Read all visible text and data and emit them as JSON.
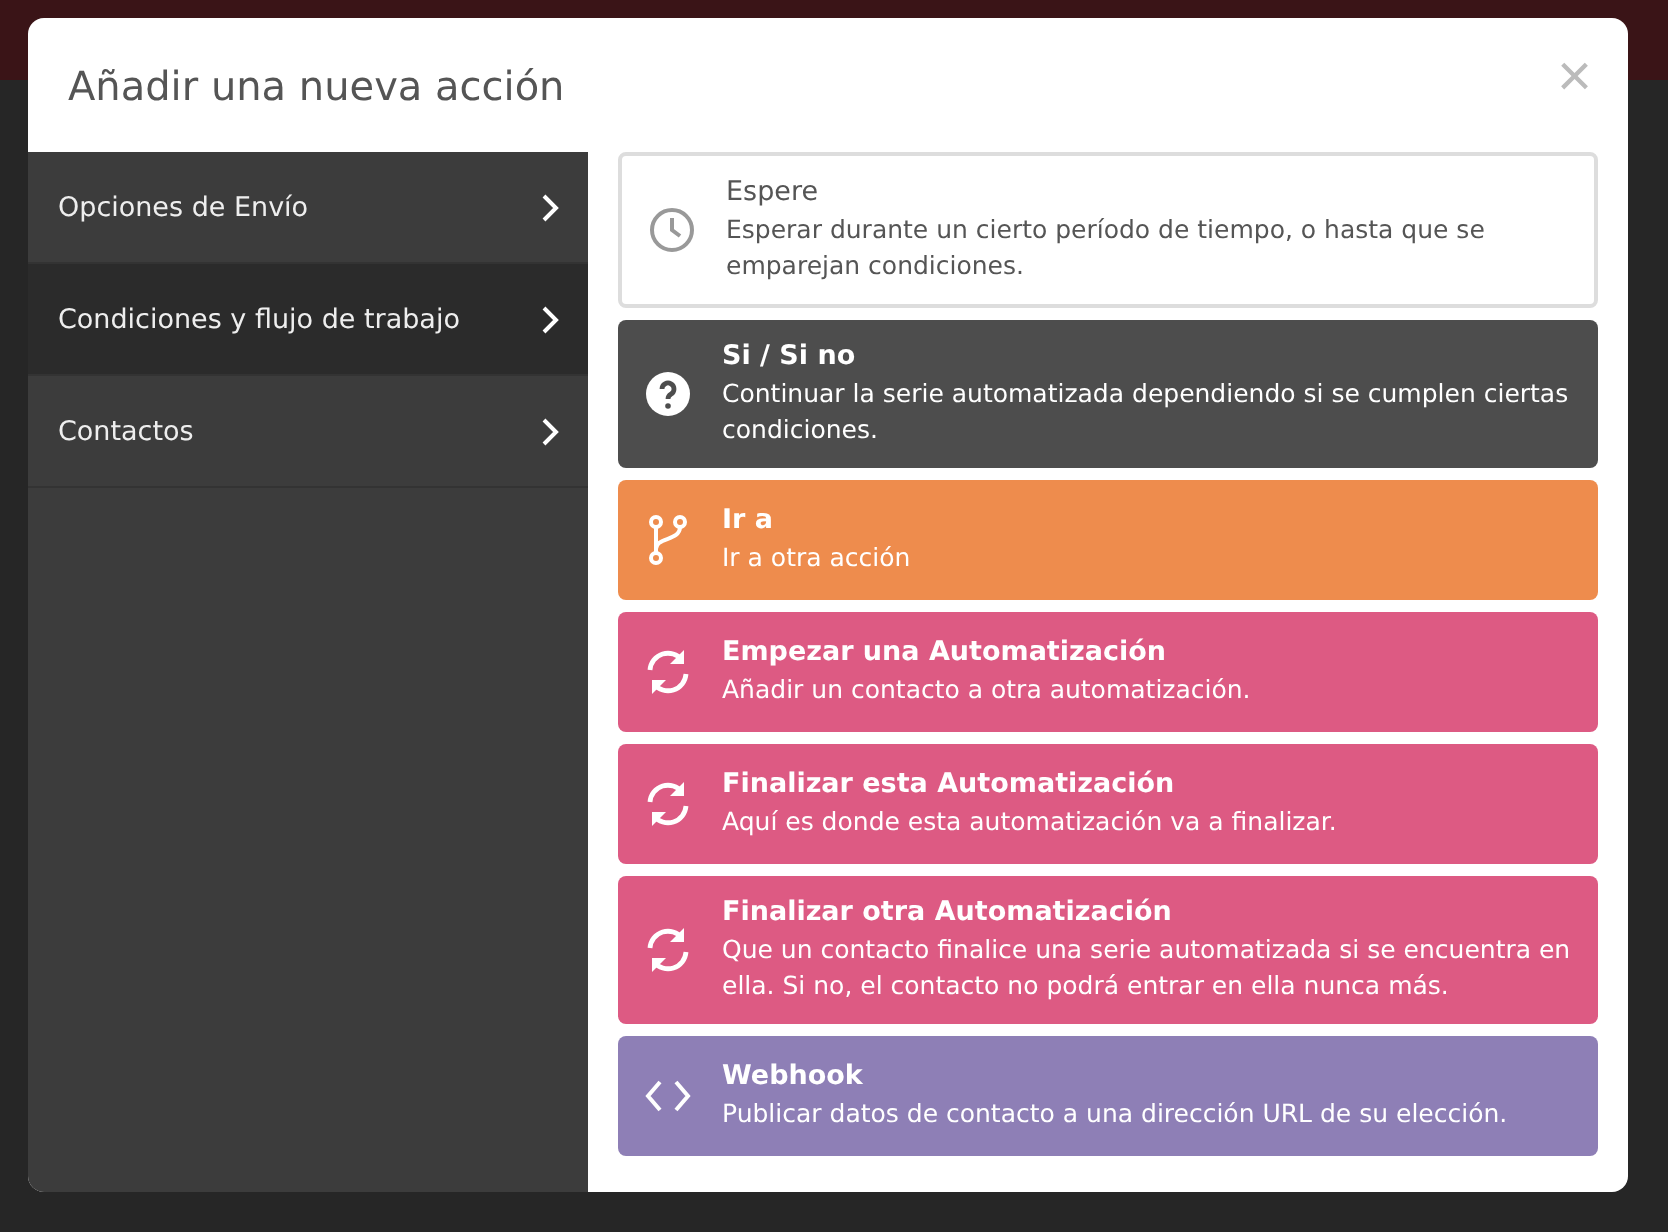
{
  "dialog": {
    "title": "Añadir una nueva acción",
    "close": "×"
  },
  "sidebar": {
    "items": [
      {
        "label": "Opciones de Envío",
        "selected": false
      },
      {
        "label": "Condiciones y flujo de trabajo",
        "selected": true
      },
      {
        "label": "Contactos",
        "selected": false
      }
    ]
  },
  "actions": [
    {
      "kind": "wait",
      "title": "Espere",
      "description": "Esperar durante un cierto período de tiempo, o hasta que se emparejan condiciones.",
      "color": "#ffffff"
    },
    {
      "kind": "condition",
      "title": "Si / Si no",
      "description": "Continuar la serie automatizada dependiendo si se cumplen ciertas condiciones.",
      "color": "#4d4d4d"
    },
    {
      "kind": "goto",
      "title": "Ir a",
      "description": "Ir a otra acción",
      "color": "#ee8c4d"
    },
    {
      "kind": "automation",
      "title": "Empezar una Automatización",
      "description": "Añadir un contacto a otra automatización.",
      "color": "#dd5a83"
    },
    {
      "kind": "automation",
      "title": "Finalizar esta Automatización",
      "description": "Aquí es donde esta automatización va a finalizar.",
      "color": "#dd5a83"
    },
    {
      "kind": "automation",
      "title": "Finalizar otra Automatización",
      "description": "Que un contacto finalice una serie automatizada si se encuentra en ella. Si no, el contacto no podrá entrar en ella nunca más.",
      "color": "#dd5a83"
    },
    {
      "kind": "webhook",
      "title": "Webhook",
      "description": "Publicar datos de contacto a una dirección URL de su elección.",
      "color": "#8e7fb6"
    }
  ]
}
